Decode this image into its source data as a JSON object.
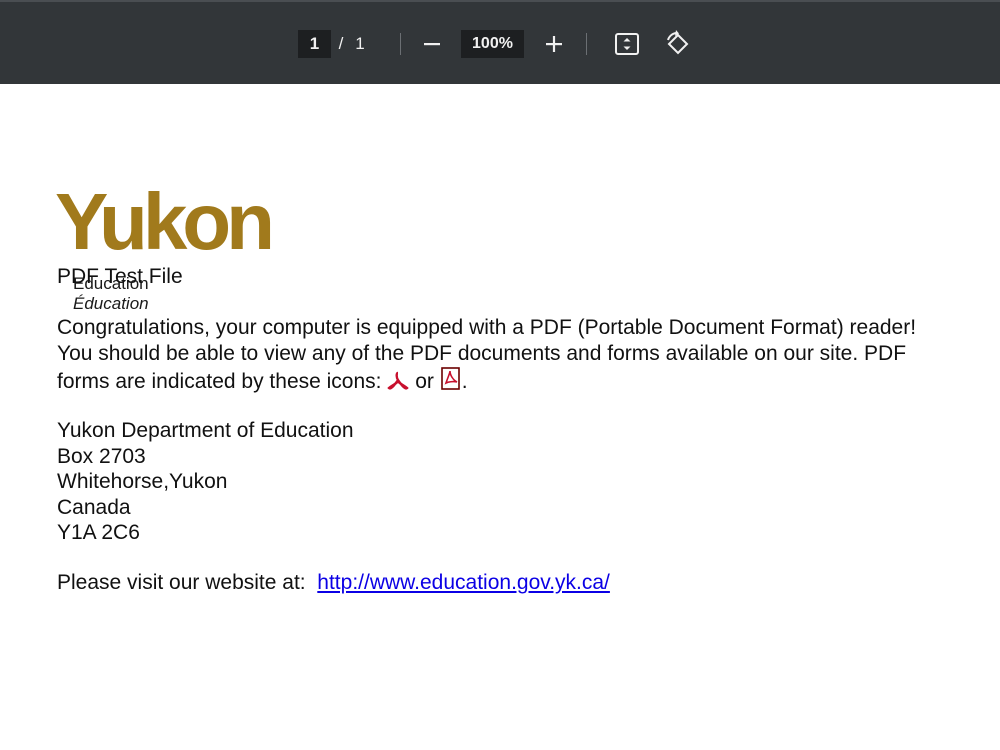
{
  "toolbar": {
    "current_page": "1",
    "page_separator": "/",
    "total_pages": "1",
    "zoom_level": "100%",
    "icons": [
      "minus-icon",
      "plus-icon",
      "fit-page-icon",
      "rotate-icon"
    ]
  },
  "document": {
    "logo": {
      "wordmark": "Yukon",
      "line1": "Education",
      "line2": "Éducation",
      "color": "#a17a1c"
    },
    "title": "PDF Test File",
    "paragraph_part1": "Congratulations, your computer is equipped with a PDF (Portable Document Format) reader!  You should be able to view any of the PDF documents and forms available on our site.  PDF forms are indicated by these icons:",
    "paragraph_or": "or",
    "paragraph_end": ".",
    "address": [
      "Yukon Department of Education",
      "Box 2703",
      "Whitehorse,Yukon",
      "Canada",
      "Y1A 2C6"
    ],
    "visit_text": "Please visit our website at:",
    "website_url": "http://www.education.gov.yk.ca/",
    "link_color": "#0b00e5"
  }
}
